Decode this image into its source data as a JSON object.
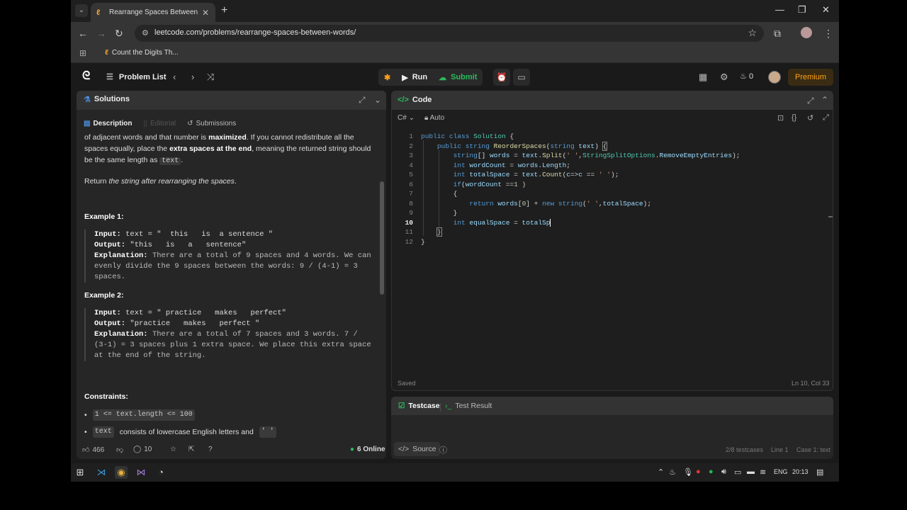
{
  "browser": {
    "tab_title": "Rearrange Spaces Between Wo",
    "url": "leetcode.com/problems/rearrange-spaces-between-words/",
    "bookmark": "Count the Digits Th..."
  },
  "lc_nav": {
    "problem_list": "Problem List",
    "run": "Run",
    "submit": "Submit",
    "streak": "0",
    "premium": "Premium"
  },
  "left_panel": {
    "title": "Solutions",
    "tabs": [
      "Description",
      "Editorial",
      "Submissions"
    ],
    "para1_pre": "of adjacent words and that number is ",
    "para1_bold1": "maximized",
    "para1_mid": ". If you cannot redistribute all the spaces equally, place the ",
    "para1_bold2": "extra spaces at the end",
    "para1_post": ", meaning the returned string should be the same length as ",
    "para1_code": "text",
    "para1_end": ".",
    "return_pre": "Return ",
    "return_em": "the string after rearranging the spaces",
    "return_end": ".",
    "example1": {
      "heading": "Example 1:",
      "input_label": "Input:",
      "input_value": "text = \"  this   is  a sentence \"",
      "output_label": "Output:",
      "output_value": "\"this   is   a   sentence\"",
      "explanation_label": "Explanation:",
      "explanation_value": "There are a total of 9 spaces and 4 words. We can evenly divide the 9 spaces between the words: 9 / (4-1) = 3 spaces."
    },
    "example2": {
      "heading": "Example 2:",
      "input_label": "Input:",
      "input_value": "text = \" practice   makes   perfect\"",
      "output_label": "Output:",
      "output_value": "\"practice   makes   perfect \"",
      "explanation_label": "Explanation:",
      "explanation_value": "There are a total of 7 spaces and 3 words. 7 / (3-1) = 3 spaces plus 1 extra space. We place this extra space at the end of the string."
    },
    "constraints": {
      "heading": "Constraints:",
      "item1": "1 <= text.length <= 100",
      "item2_code": "text",
      "item2_text": "consists of lowercase English letters and",
      "item2_code2": "' '"
    },
    "footer": {
      "likes": "466",
      "comments": "10",
      "online": "6 Online"
    }
  },
  "code_panel": {
    "title": "Code",
    "language": "C#",
    "mode": "Auto",
    "status": "Saved",
    "cursor_pos": "Ln 10, Col 33",
    "line_numbers": [
      "1",
      "2",
      "3",
      "4",
      "5",
      "6",
      "7",
      "8",
      "9",
      "10",
      "11",
      "12"
    ]
  },
  "test_panel": {
    "tab1": "Testcase",
    "tab2": "Test Result",
    "source": "Source",
    "testcases": "2/8 testcases",
    "line": "Line 1",
    "case": "Case 1: text"
  },
  "taskbar": {
    "lang": "ENG",
    "time": "20:13"
  },
  "colors": {
    "accent_green": "#2cbb5d",
    "premium_orange": "#ffa116"
  }
}
